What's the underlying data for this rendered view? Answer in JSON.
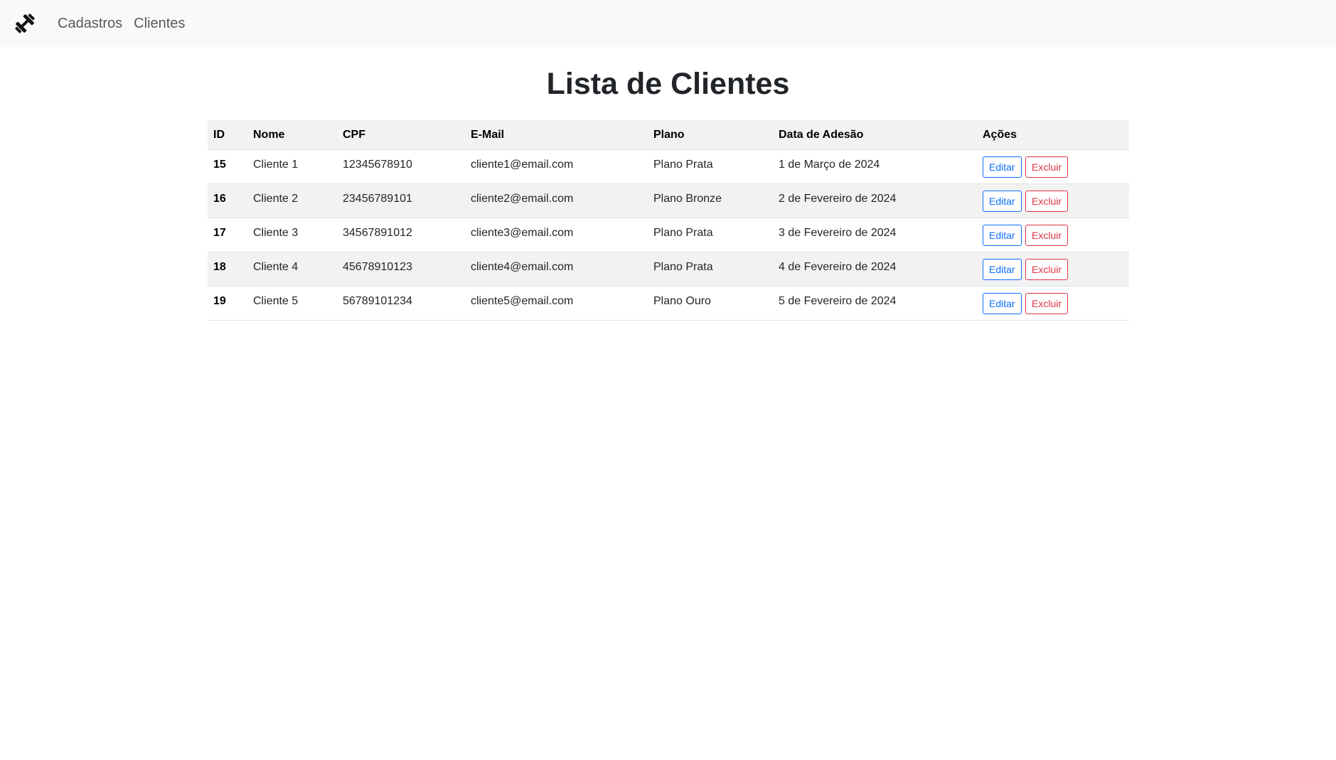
{
  "navbar": {
    "brand_icon": "dumbbell-icon",
    "links": [
      {
        "label": "Cadastros"
      },
      {
        "label": "Clientes"
      }
    ]
  },
  "page": {
    "title": "Lista de Clientes"
  },
  "table": {
    "headers": [
      "ID",
      "Nome",
      "CPF",
      "E-Mail",
      "Plano",
      "Data de Adesão",
      "Ações"
    ],
    "rows": [
      {
        "id": "15",
        "nome": "Cliente 1",
        "cpf": "12345678910",
        "email": "cliente1@email.com",
        "plano": "Plano Prata",
        "data": "1 de Março de 2024",
        "edit_label": "Editar",
        "delete_label": "Excluir"
      },
      {
        "id": "16",
        "nome": "Cliente 2",
        "cpf": "23456789101",
        "email": "cliente2@email.com",
        "plano": "Plano Bronze",
        "data": "2 de Fevereiro de 2024",
        "edit_label": "Editar",
        "delete_label": "Excluir"
      },
      {
        "id": "17",
        "nome": "Cliente 3",
        "cpf": "34567891012",
        "email": "cliente3@email.com",
        "plano": "Plano Prata",
        "data": "3 de Fevereiro de 2024",
        "edit_label": "Editar",
        "delete_label": "Excluir"
      },
      {
        "id": "18",
        "nome": "Cliente 4",
        "cpf": "45678910123",
        "email": "cliente4@email.com",
        "plano": "Plano Prata",
        "data": "4 de Fevereiro de 2024",
        "edit_label": "Editar",
        "delete_label": "Excluir"
      },
      {
        "id": "19",
        "nome": "Cliente 5",
        "cpf": "56789101234",
        "email": "cliente5@email.com",
        "plano": "Plano Ouro",
        "data": "5 de Fevereiro de 2024",
        "edit_label": "Editar",
        "delete_label": "Excluir"
      }
    ]
  },
  "colors": {
    "navbar_bg": "#f8f9fa",
    "edit_button": "#0d6efd",
    "delete_button": "#dc3545",
    "stripe": "#f2f2f2"
  }
}
